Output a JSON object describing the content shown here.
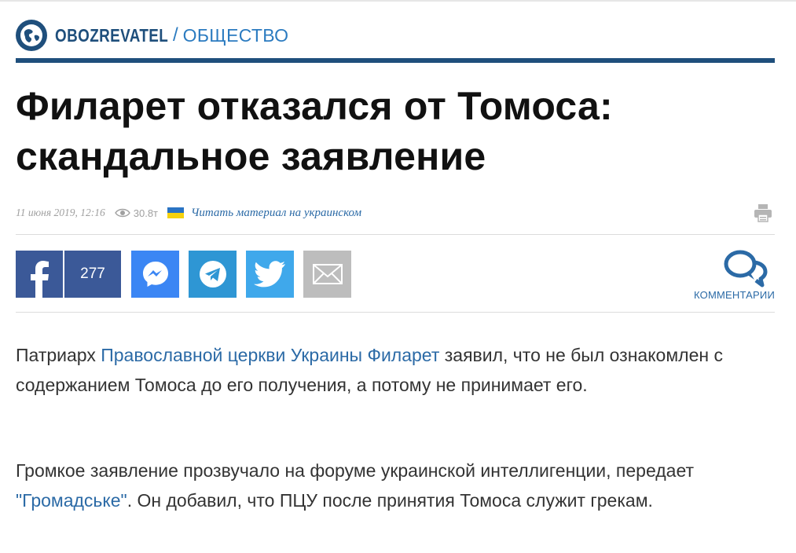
{
  "header": {
    "brand": "OBOZREVATEL",
    "separator": "/",
    "section": "ОБЩЕСТВО",
    "brand_color": "#1f4f7c",
    "logo_icon": "globe-icon"
  },
  "article": {
    "title_line1": "Филарет отказался от Томоса:",
    "title_line2": "скандальное заявление",
    "date": "11 июня 2019, 12:16",
    "views": "30.8т",
    "ukrainian_link": "Читать материал на украинском"
  },
  "share": {
    "facebook_count": "277",
    "buttons": [
      "facebook",
      "messenger",
      "telegram",
      "twitter",
      "email"
    ],
    "colors": {
      "facebook": "#3b5998",
      "messenger": "#3b86f4",
      "telegram": "#2e96d4",
      "twitter": "#3fa8eb",
      "email": "#bdbdbd"
    }
  },
  "comments": {
    "label": "КОММЕНТАРИИ"
  },
  "body": {
    "p1_before": "Патриарх ",
    "p1_link": "Православной церкви Украины Филарет",
    "p1_after": " заявил, что не был ознакомлен с содержанием Томоса до его получения, а потому не принимает его.",
    "p2_before": "Громкое заявление прозвучало на форуме украинской интеллигенции, передает ",
    "p2_link": "\"Громадське\"",
    "p2_after": ". Он добавил, что ПЦУ после принятия Томоса служит грекам."
  }
}
